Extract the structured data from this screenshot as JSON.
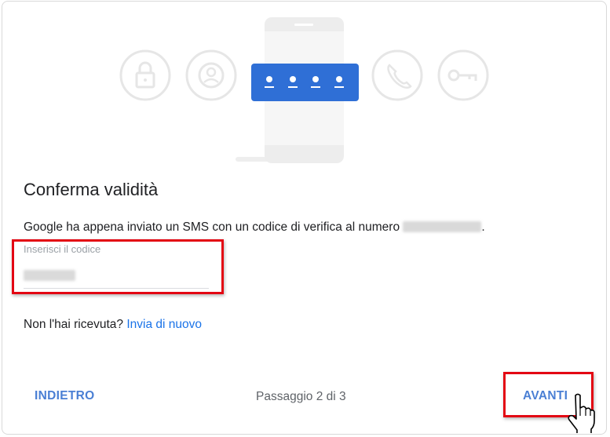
{
  "dialog": {
    "title": "Conferma validità",
    "description": "Google ha appena inviato un SMS con un codice di verifica al numero ",
    "description_end": ".",
    "code_field": {
      "label": "Inserisci il codice"
    },
    "resend": {
      "question": "Non l'hai ricevuta? ",
      "link": "Invia di nuovo"
    },
    "footer": {
      "back_label": "INDIETRO",
      "step_text": "Passaggio 2 di 3",
      "next_label": "AVANTI"
    }
  },
  "colors": {
    "accent": "#1a73e8",
    "highlight": "#e30613",
    "phone_panel": "#2f6fd6"
  },
  "icons": [
    "lock-icon",
    "account-icon",
    "passcode-icon",
    "phone-icon",
    "key-icon",
    "hand-cursor-icon"
  ]
}
